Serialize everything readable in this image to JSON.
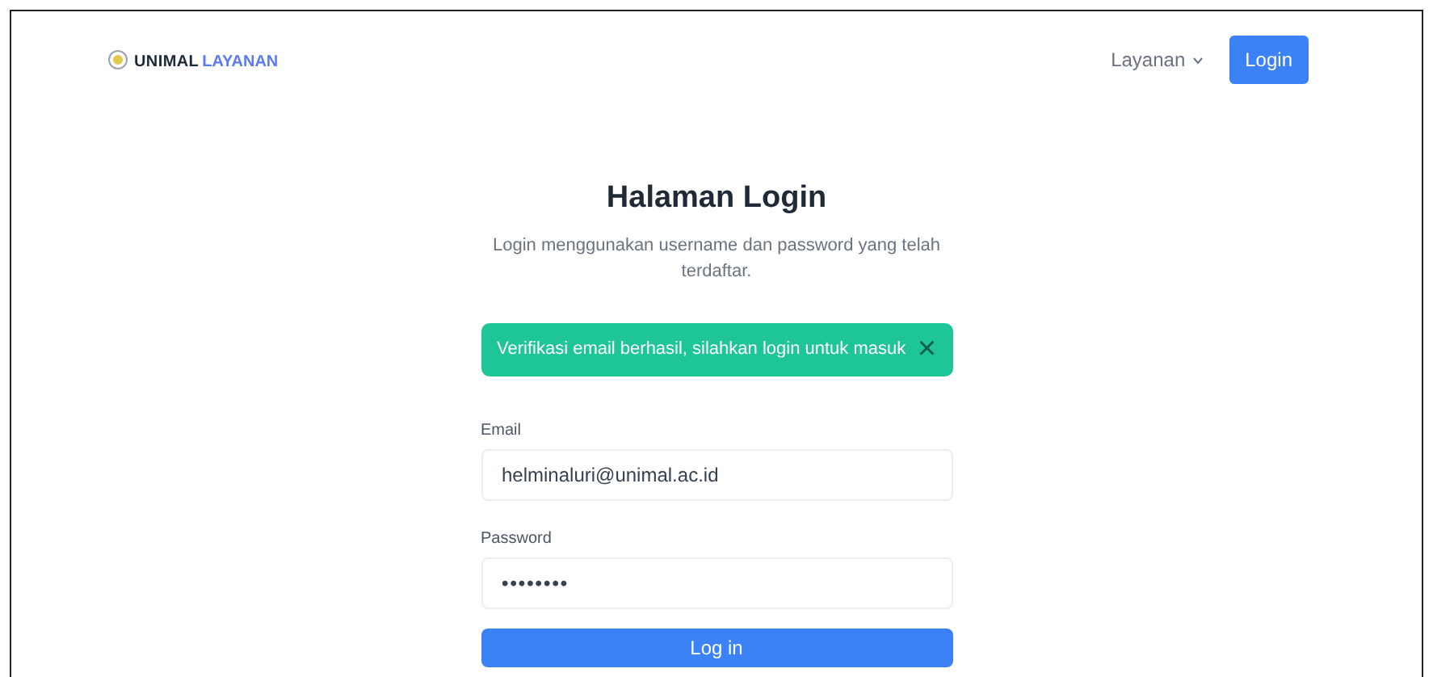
{
  "navbar": {
    "brand": {
      "part_1": "UNIMAL",
      "part_2": "LAYANAN"
    },
    "menu": {
      "label": "Layanan",
      "expanded": false
    },
    "login_button": "Login"
  },
  "login": {
    "title": "Halaman Login",
    "subtitle": "Login menggunakan username dan password yang telah terdaftar.",
    "alert": {
      "message": "Verifikasi email berhasil, silahkan login untuk masuk",
      "close": "×"
    },
    "fields": [
      {
        "label": "Email",
        "value": "helminaluri@unimal.ac.id",
        "kind": "text"
      },
      {
        "label": "Password",
        "value": "••••••••",
        "kind": "password"
      }
    ],
    "submit": "Log in"
  }
}
